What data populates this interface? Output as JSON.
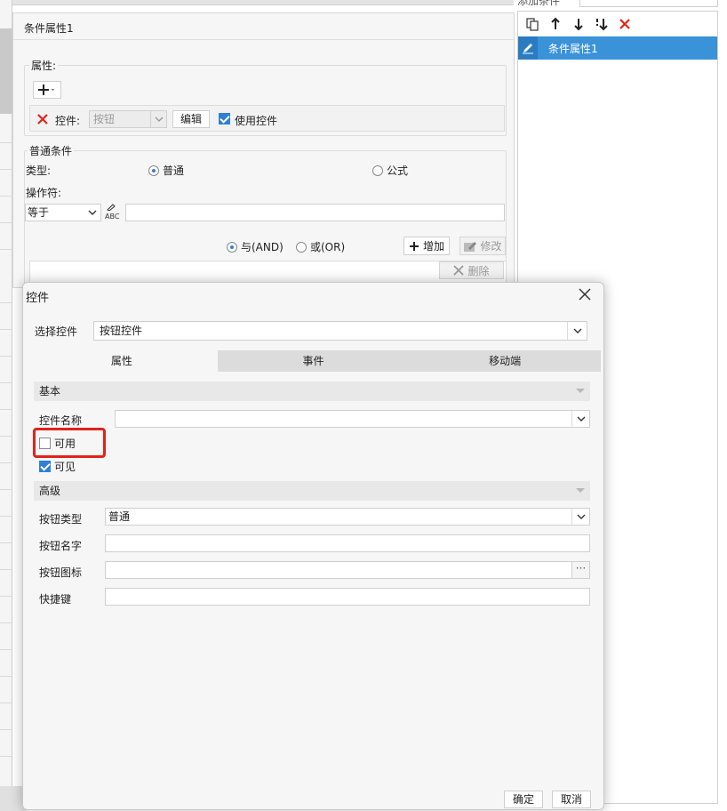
{
  "top_bar": {
    "dots": "···",
    "right_label": "添加条件"
  },
  "right_panel": {
    "item_label": "条件属性1"
  },
  "condition_window": {
    "title": "条件属性1",
    "property_section_label": "属性:",
    "control_label": "控件:",
    "control_value": "按钮",
    "edit_button": "编辑",
    "use_control_label": "使用控件",
    "normal_condition_label": "普通条件",
    "type_label": "类型:",
    "type_normal": "普通",
    "type_formula": "公式",
    "operator_label": "操作符:",
    "operator_value": "等于",
    "abc_glyph": "ABC",
    "and_label": "与(AND)",
    "or_label": "或(OR)",
    "add_button": "增加",
    "modify_button": "修改",
    "delete_button": "删除"
  },
  "dialog": {
    "title": "控件",
    "select_control_label": "选择控件",
    "select_control_value": "按钮控件",
    "tabs": [
      "属性",
      "事件",
      "移动端"
    ],
    "active_tab": "属性",
    "section_basic": "基本",
    "control_name_label": "控件名称",
    "control_name_value": "",
    "enabled_label": "可用",
    "enabled_checked": false,
    "visible_label": "可见",
    "visible_checked": true,
    "section_advanced": "高级",
    "button_type_label": "按钮类型",
    "button_type_value": "普通",
    "button_name_label": "按钮名字",
    "button_name_value": "",
    "button_icon_label": "按钮图标",
    "button_icon_value": "",
    "shortcut_label": "快捷键",
    "shortcut_value": "",
    "ok_button": "确定",
    "cancel_button": "取消",
    "icon_dots": "···"
  },
  "colors": {
    "accent": "#2f7fd6",
    "selection": "#3a92d9",
    "highlight_box": "#e0231c",
    "delete_red": "#e0231c"
  }
}
